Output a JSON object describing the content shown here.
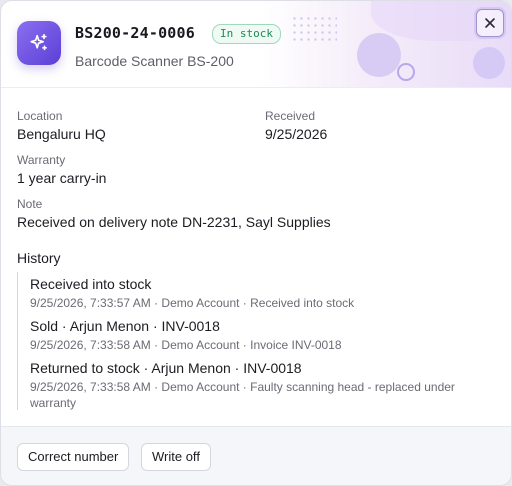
{
  "header": {
    "serial": "BS200-24-0006",
    "status_badge": "In stock",
    "product_name": "Barcode Scanner BS-200",
    "icon": "sparkles-icon",
    "close_icon": "close-icon"
  },
  "details": {
    "location_label": "Location",
    "location_value": "Bengaluru HQ",
    "received_label": "Received",
    "received_value": "9/25/2026",
    "warranty_label": "Warranty",
    "warranty_value": "1 year carry-in",
    "note_label": "Note",
    "note_value": "Received on delivery note DN-2231, Sayl Supplies"
  },
  "history": {
    "title": "History",
    "items": [
      {
        "title": "Received into stock",
        "meta": "9/25/2026, 7:33:57 AM · Demo Account · Received into stock"
      },
      {
        "title": "Sold · Arjun Menon · INV-0018",
        "meta": "9/25/2026, 7:33:58 AM · Demo Account · Invoice INV-0018"
      },
      {
        "title": "Returned to stock · Arjun Menon · INV-0018",
        "meta": "9/25/2026, 7:33:58 AM · Demo Account · Faulty scanning head - replaced under warranty"
      }
    ]
  },
  "footer": {
    "correct_number_label": "Correct number",
    "write_off_label": "Write off"
  },
  "colors": {
    "accent": "#6a4fe0",
    "badge_text": "#1f8a55",
    "badge_border": "#9fd9bc"
  }
}
